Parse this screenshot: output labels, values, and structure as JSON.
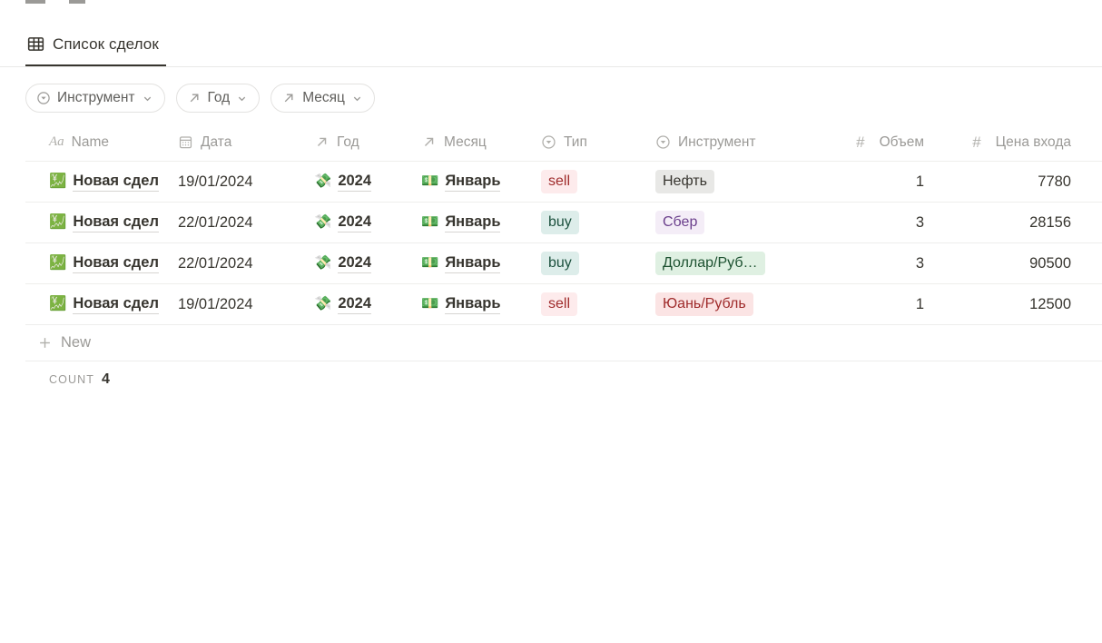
{
  "tab": {
    "label": "Список сделок",
    "icon": "table-icon"
  },
  "filters": [
    {
      "label": "Инструмент",
      "icon": "select-circle-icon",
      "chevron": "chevron-down-icon"
    },
    {
      "label": "Год",
      "icon": "relation-arrow-icon",
      "chevron": "chevron-down-icon"
    },
    {
      "label": "Месяц",
      "icon": "relation-arrow-icon",
      "chevron": "chevron-down-icon"
    }
  ],
  "table": {
    "columns": [
      {
        "key": "name",
        "label": "Name",
        "icon": "title-aa-icon"
      },
      {
        "key": "date",
        "label": "Дата",
        "icon": "calendar-icon"
      },
      {
        "key": "year",
        "label": "Год",
        "icon": "relation-arrow-icon"
      },
      {
        "key": "month",
        "label": "Месяц",
        "icon": "relation-arrow-icon"
      },
      {
        "key": "type",
        "label": "Тип",
        "icon": "select-circle-icon"
      },
      {
        "key": "instr",
        "label": "Инструмент",
        "icon": "select-circle-icon"
      },
      {
        "key": "vol",
        "label": "Объем",
        "icon": "number-hash-icon"
      },
      {
        "key": "price",
        "label": "Цена входа",
        "icon": "number-hash-icon"
      }
    ],
    "rows": [
      {
        "name_emoji": "💹",
        "name": "Новая сдел",
        "date": "19/01/2024",
        "year_emoji": "💸",
        "year": "2024",
        "month_emoji": "💵",
        "month": "Январь",
        "type": "sell",
        "type_color": "red",
        "instrument": "Нефть",
        "instrument_color": "gray",
        "volume": "1",
        "price": "7780"
      },
      {
        "name_emoji": "💹",
        "name": "Новая сдел",
        "date": "22/01/2024",
        "year_emoji": "💸",
        "year": "2024",
        "month_emoji": "💵",
        "month": "Январь",
        "type": "buy",
        "type_color": "green",
        "instrument": "Сбер",
        "instrument_color": "purple",
        "volume": "3",
        "price": "28156"
      },
      {
        "name_emoji": "💹",
        "name": "Новая сдел",
        "date": "22/01/2024",
        "year_emoji": "💸",
        "year": "2024",
        "month_emoji": "💵",
        "month": "Январь",
        "type": "buy",
        "type_color": "green",
        "instrument": "Доллар/Руб…",
        "instrument_color": "green2",
        "volume": "3",
        "price": "90500"
      },
      {
        "name_emoji": "💹",
        "name": "Новая сдел",
        "date": "19/01/2024",
        "year_emoji": "💸",
        "year": "2024",
        "month_emoji": "💵",
        "month": "Январь",
        "type": "sell",
        "type_color": "red",
        "instrument": "Юань/Рубль",
        "instrument_color": "pink",
        "volume": "1",
        "price": "12500"
      }
    ],
    "new_row_label": "New",
    "footer": {
      "label": "COUNT",
      "value": "4"
    }
  },
  "colors": {
    "text": "#37352f",
    "muted": "#9b9a97",
    "border": "#eeeeec",
    "tag_red_bg": "#fdebec",
    "tag_red_fg": "#9f2b2b",
    "tag_green_bg": "#ddedea",
    "tag_green_fg": "#1c513e",
    "tag_gray_bg": "#e8e8e6",
    "tag_purple_bg": "#f4edf7",
    "tag_purple_fg": "#6b3f8c",
    "tag_pink_bg": "#fbe4e4"
  }
}
